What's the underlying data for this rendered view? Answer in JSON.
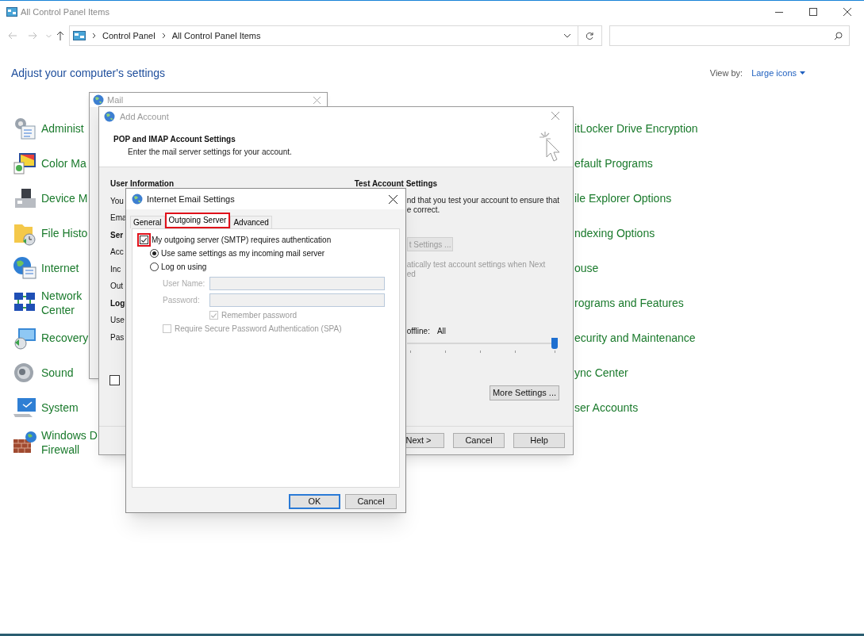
{
  "window": {
    "title": "All Control Panel Items"
  },
  "address_bar": {
    "path": [
      "Control Panel",
      "All Control Panel Items"
    ]
  },
  "header": {
    "title": "Adjust your computer's settings",
    "view_by_label": "View by:",
    "view_by_value": "Large icons"
  },
  "items_left": [
    {
      "lines": [
        "Administ"
      ]
    },
    {
      "lines": [
        "Color Ma"
      ]
    },
    {
      "lines": [
        "Device M"
      ]
    },
    {
      "lines": [
        "File Histo"
      ]
    },
    {
      "lines": [
        "Internet"
      ]
    },
    {
      "lines": [
        "Network",
        "Center"
      ]
    },
    {
      "lines": [
        "Recovery"
      ]
    },
    {
      "lines": [
        "Sound"
      ]
    },
    {
      "lines": [
        "System"
      ]
    },
    {
      "lines": [
        "Windows D",
        "Firewall"
      ]
    }
  ],
  "items_right": [
    {
      "lines": [
        "itLocker Drive Encryption"
      ]
    },
    {
      "lines": [
        "efault Programs"
      ]
    },
    {
      "lines": [
        "ile Explorer Options"
      ]
    },
    {
      "lines": [
        "ndexing Options"
      ]
    },
    {
      "lines": [
        "ouse"
      ]
    },
    {
      "lines": [
        "rograms and Features"
      ]
    },
    {
      "lines": [
        "ecurity and Maintenance"
      ]
    },
    {
      "lines": [
        "ync Center"
      ]
    },
    {
      "lines": [
        "ser Accounts"
      ]
    }
  ],
  "mail_window": {
    "title": "Mail"
  },
  "add_account": {
    "title": "Add Account",
    "heading": "POP and IMAP Account Settings",
    "subheading": "Enter the mail server settings for your account.",
    "left_labels": [
      {
        "text": "User Information",
        "kind": "heading"
      },
      {
        "text": "You",
        "kind": "label"
      },
      {
        "text": "Ema",
        "kind": "label"
      },
      {
        "text": "Ser",
        "kind": "heading"
      },
      {
        "text": "Acc",
        "kind": "label"
      },
      {
        "text": "Inc",
        "kind": "label"
      },
      {
        "text": "Out",
        "kind": "label"
      },
      {
        "text": "Log",
        "kind": "heading"
      },
      {
        "text": "Use",
        "kind": "label"
      },
      {
        "text": "Pas",
        "kind": "label"
      }
    ],
    "left_checkbox": {
      "checked": false
    },
    "test_settings": {
      "heading": "Test Account Settings",
      "text_1": "nd that you test your account to ensure that",
      "text_2": "e correct.",
      "test_button": "t Settings ...",
      "text_3": "atically test account settings when Next",
      "text_4": "ed",
      "offline_label": "offline:",
      "offline_value": "All",
      "slider": {
        "level": 1
      }
    },
    "more_settings": "More Settings ...",
    "buttons": [
      "Next >",
      "Cancel",
      "Help"
    ]
  },
  "email_settings": {
    "title": "Internet Email Settings",
    "tabs": [
      {
        "label": "General",
        "selected": false,
        "highlighted": false
      },
      {
        "label": "Outgoing Server",
        "selected": true,
        "highlighted": true
      },
      {
        "label": "Advanced",
        "selected": false,
        "highlighted": false
      }
    ],
    "auth": {
      "label": "My outgoing server (SMTP) requires authentication",
      "checked": true,
      "highlighted": true
    },
    "options": [
      {
        "label": "Use same settings as my incoming mail server",
        "selected": true
      },
      {
        "label": "Log on using",
        "selected": false
      }
    ],
    "fields": [
      {
        "label": "User Name:",
        "disabled": true
      },
      {
        "label": "Password:",
        "disabled": true
      }
    ],
    "remember": {
      "label": "Remember password",
      "checked": true,
      "disabled": true
    },
    "spa": {
      "label": "Require Secure Password Authentication (SPA)",
      "checked": false,
      "disabled": true
    },
    "buttons": [
      {
        "label": "OK",
        "default": true
      },
      {
        "label": "Cancel",
        "default": false
      }
    ]
  }
}
